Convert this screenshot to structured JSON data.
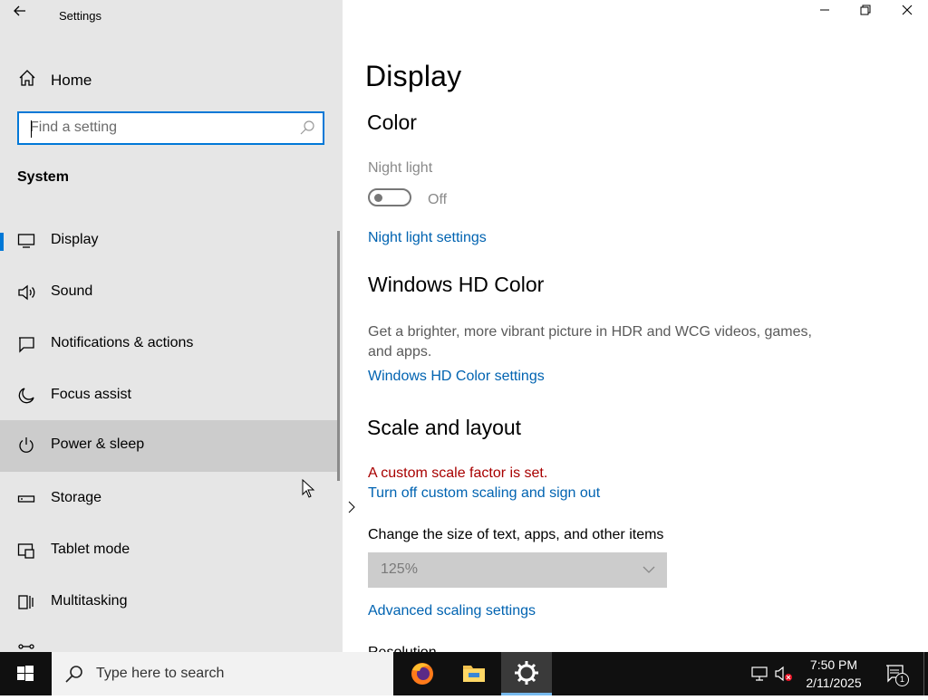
{
  "window": {
    "title": "Settings"
  },
  "sidebar": {
    "home_label": "Home",
    "search_placeholder": "Find a setting",
    "section": "System",
    "items": [
      {
        "label": "Display",
        "icon": "monitor-icon"
      },
      {
        "label": "Sound",
        "icon": "speaker-icon"
      },
      {
        "label": "Notifications & actions",
        "icon": "notification-icon"
      },
      {
        "label": "Focus assist",
        "icon": "moon-icon"
      },
      {
        "label": "Power & sleep",
        "icon": "power-icon"
      },
      {
        "label": "Storage",
        "icon": "storage-icon"
      },
      {
        "label": "Tablet mode",
        "icon": "tablet-mode-icon"
      },
      {
        "label": "Multitasking",
        "icon": "multitasking-icon"
      }
    ]
  },
  "main": {
    "page_title": "Display",
    "color_heading": "Color",
    "night_light_label": "Night light",
    "night_light_state": "Off",
    "night_light_settings_link": "Night light settings",
    "hd_color_heading": "Windows HD Color",
    "hd_color_desc": "Get a brighter, more vibrant picture in HDR and WCG videos, games, and apps.",
    "hd_color_link": "Windows HD Color settings",
    "scale_heading": "Scale and layout",
    "custom_scale_warning": "A custom scale factor is set.",
    "turn_off_scaling_link": "Turn off custom scaling and sign out",
    "size_label": "Change the size of text, apps, and other items",
    "scale_value": "125%",
    "advanced_scaling_link": "Advanced scaling settings",
    "resolution_label": "Resolution"
  },
  "taskbar": {
    "search_placeholder": "Type here to search",
    "time": "7:50 PM",
    "date": "2/11/2025",
    "notification_count": "1"
  },
  "colors": {
    "accent": "#0078d7",
    "link": "#0063b1",
    "warning": "#a80000",
    "sidebar_bg": "#e6e6e6",
    "taskbar_bg": "#101010"
  }
}
